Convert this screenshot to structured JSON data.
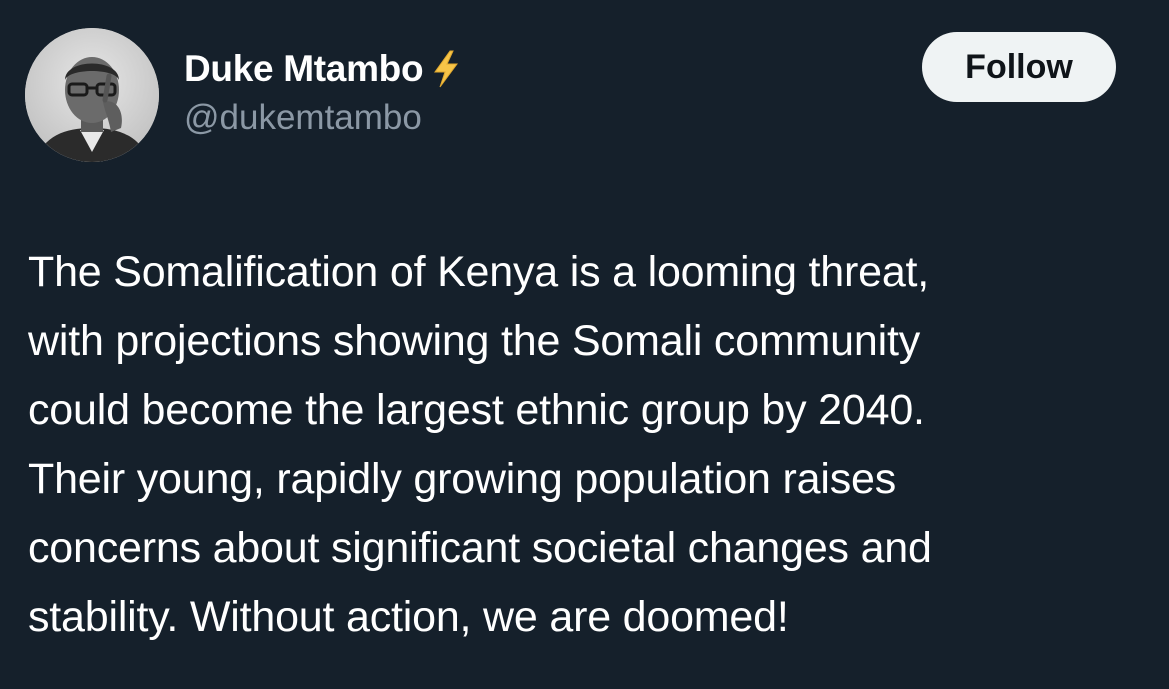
{
  "author": {
    "display_name": "Duke Mtambo",
    "badge_icon": "lightning-bolt-icon",
    "handle": "@dukemtambo",
    "avatar_icon": "profile-photo"
  },
  "follow_button": {
    "label": "Follow"
  },
  "tweet": {
    "lines": [
      "The Somalification of Kenya is a looming threat,",
      "with projections showing the Somali community",
      "could become the largest ethnic group by 2040.",
      "Their young, rapidly growing population raises",
      "concerns about significant societal changes and",
      "stability. Without action, we are doomed!"
    ]
  },
  "colors": {
    "background": "#15202b",
    "handle": "#8b98a5",
    "button_bg": "#eff3f4",
    "button_text": "#0f1419",
    "bolt": "#f7c548"
  }
}
